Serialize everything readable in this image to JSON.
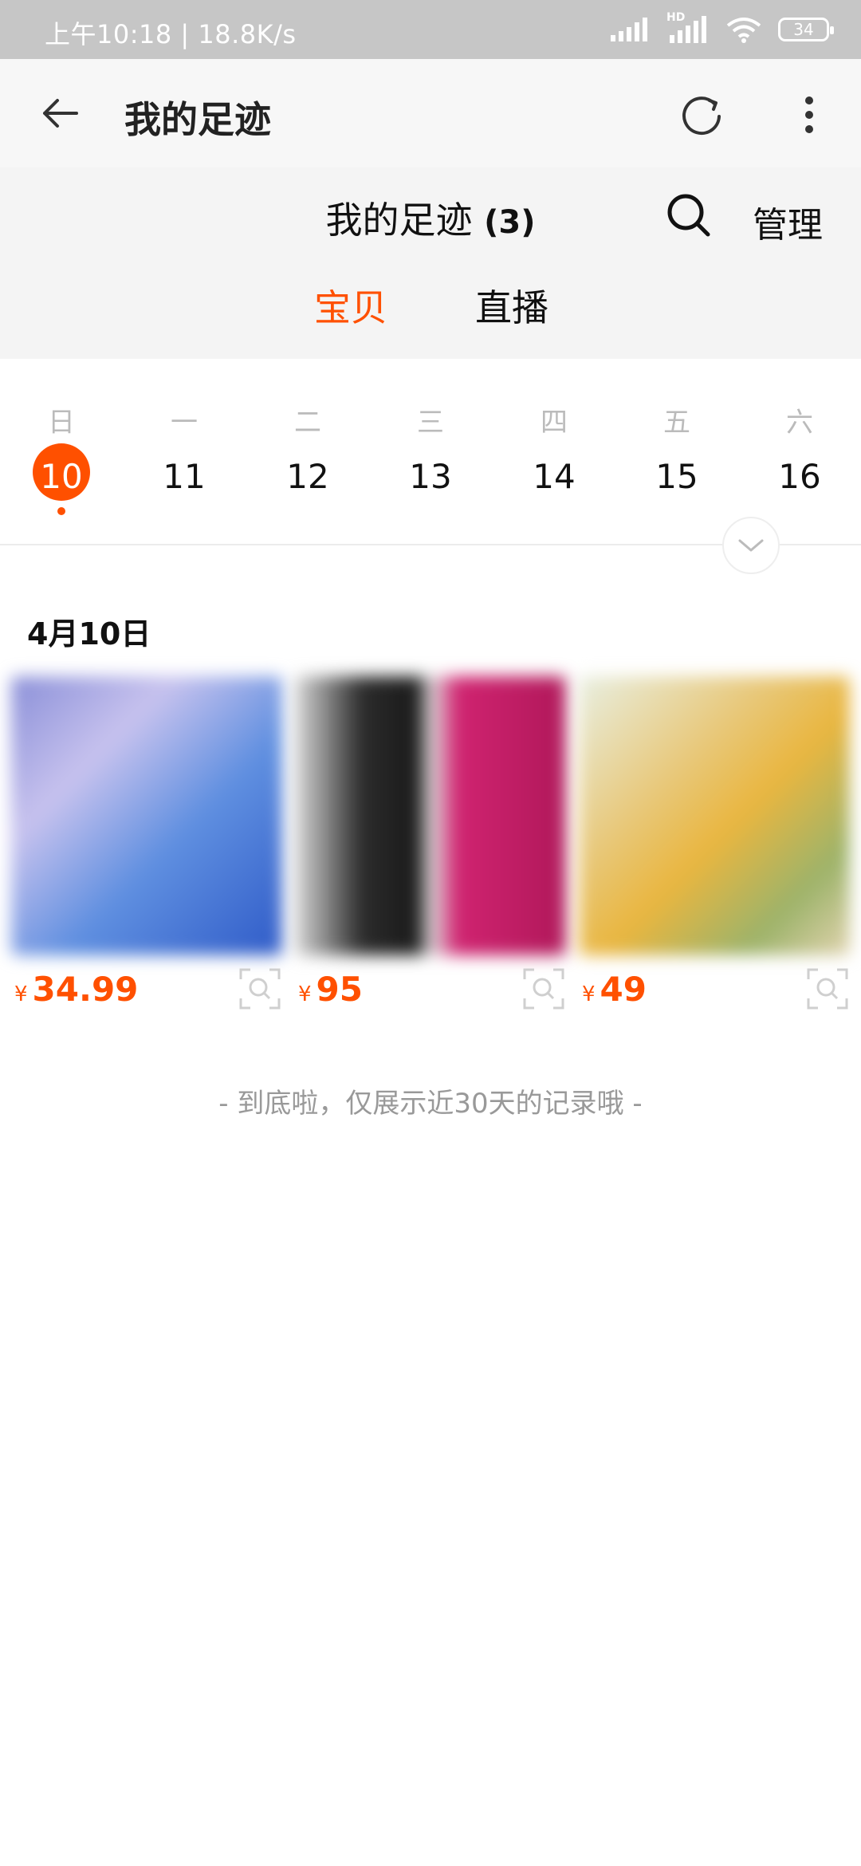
{
  "status_bar": {
    "left_text": "上午10:18 | 18.8K/s",
    "network_label": "HD",
    "battery": "34"
  },
  "app_bar": {
    "title": "我的足迹"
  },
  "header": {
    "title": "我的足迹",
    "count": "(3)",
    "manage_label": "管理"
  },
  "tabs": [
    {
      "label": "宝贝",
      "active": true
    },
    {
      "label": "直播",
      "active": false
    }
  ],
  "calendar": {
    "days": [
      {
        "weekday": "日",
        "date": "10",
        "selected": true
      },
      {
        "weekday": "一",
        "date": "11"
      },
      {
        "weekday": "二",
        "date": "12"
      },
      {
        "weekday": "三",
        "date": "13"
      },
      {
        "weekday": "四",
        "date": "14"
      },
      {
        "weekday": "五",
        "date": "15"
      },
      {
        "weekday": "六",
        "date": "16"
      }
    ]
  },
  "section": {
    "date_heading": "4月10日"
  },
  "products": [
    {
      "currency": "¥",
      "price": "34.99"
    },
    {
      "currency": "¥",
      "price": "95"
    },
    {
      "currency": "¥",
      "price": "49"
    }
  ],
  "footer_text": "- 到底啦，仅展示近30天的记录哦 -",
  "colors": {
    "accent": "#ff5000",
    "status_bar_bg": "#c6c6c6",
    "app_bar_bg": "#f7f7f7"
  }
}
